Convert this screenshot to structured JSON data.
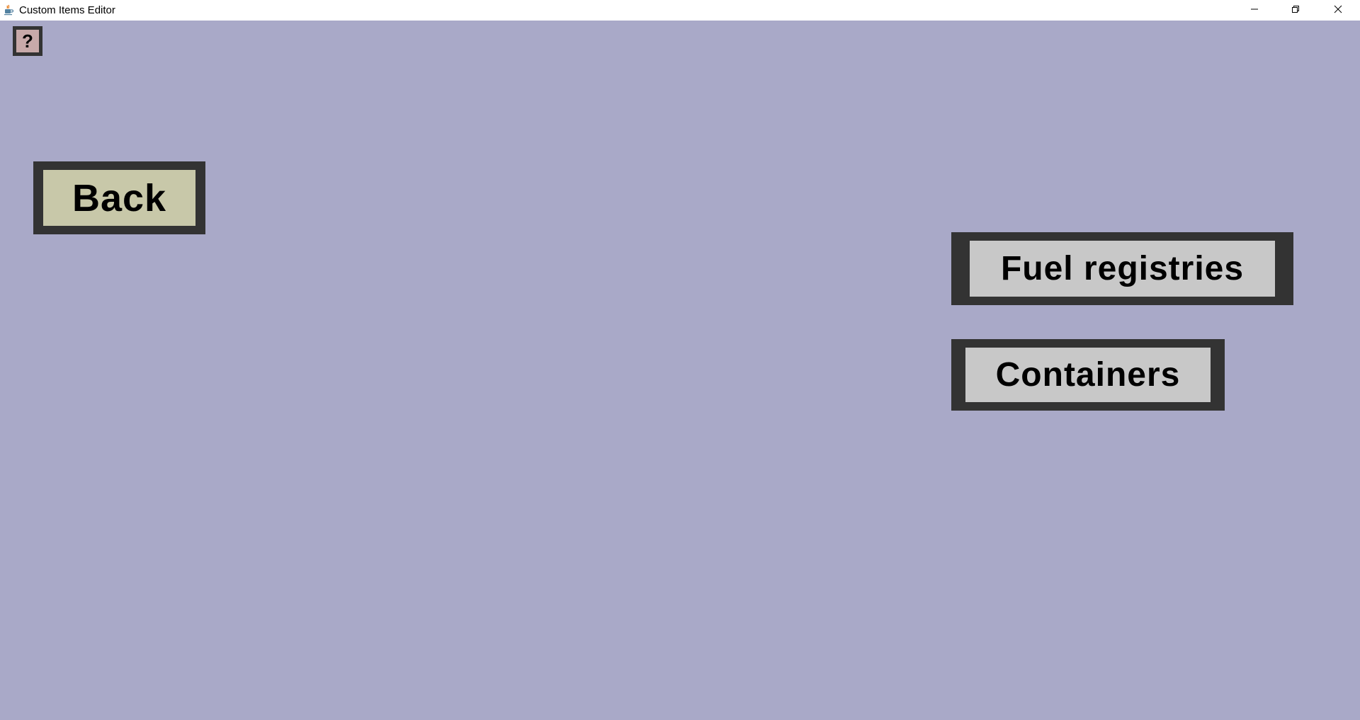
{
  "window": {
    "title": "Custom Items Editor",
    "icon": "java-cup-icon",
    "controls": {
      "minimize_icon": "minimize-icon",
      "maximize_icon": "restore-icon",
      "close_icon": "close-icon"
    }
  },
  "toolbar": {
    "help_label": "?"
  },
  "menu": {
    "back_label": "Back",
    "fuel_registries_label": "Fuel registries",
    "containers_label": "Containers"
  },
  "colors": {
    "background": "#a9a9c8",
    "tile_border": "#333333",
    "back_fill": "#c8c8a9",
    "button_fill": "#c8c8c8",
    "help_fill": "#c8a9a9"
  }
}
